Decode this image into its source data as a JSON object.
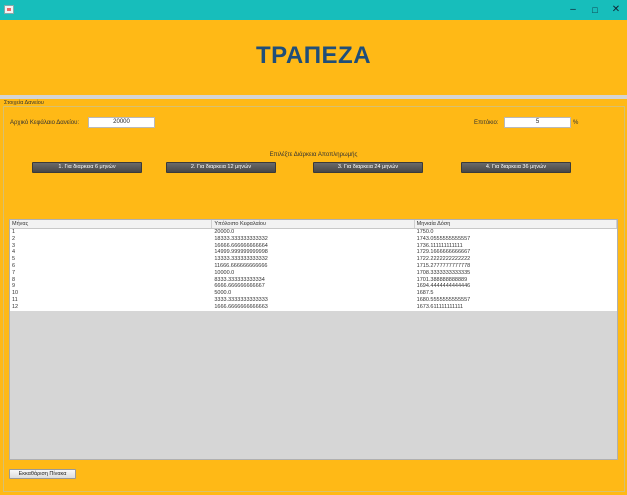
{
  "window": {
    "minimize": "–",
    "maximize": "□",
    "close": "✕"
  },
  "header": {
    "title": "ΤΡΑΠΕΖΑ"
  },
  "panel": {
    "title": "Στοιχεία Δανείου"
  },
  "form": {
    "capital_label": "Αρχικό Κεφάλαιο Δανείου:",
    "capital_value": "20000",
    "rate_label": "Επιτόκιο:",
    "rate_value": "5",
    "rate_unit": "%"
  },
  "duration": {
    "label": "Επιλέξτε Διάρκεια Αποπληρωμής",
    "buttons": [
      "1. Για διαρκεια 6 μηνών",
      "2. Για διαρκεια 12 μηνών",
      "3. Για διαρκεια 24 μηνών",
      "4. Για διαρκεια 36 μηνών"
    ]
  },
  "table": {
    "headers": [
      "Μήνας",
      "Υπόλοιπο Κεφαλαίου",
      "Μηνιαία Δόση"
    ],
    "rows": [
      [
        "1",
        "20000.0",
        "1750.0"
      ],
      [
        "2",
        "18333.333333333332",
        "1743.0555555555557"
      ],
      [
        "3",
        "16666.666666666664",
        "1736.111111111111"
      ],
      [
        "4",
        "14999.999999999998",
        "1729.1666666666667"
      ],
      [
        "5",
        "13333.333333333332",
        "1722.2222222222222"
      ],
      [
        "6",
        "11666.666666666666",
        "1715.2777777777778"
      ],
      [
        "7",
        "10000.0",
        "1708.3333333333335"
      ],
      [
        "8",
        "8333.333333333334",
        "1701.388888888889"
      ],
      [
        "9",
        "6666.666666666667",
        "1694.4444444444446"
      ],
      [
        "10",
        "5000.0",
        "1687.5"
      ],
      [
        "11",
        "3333.3333333333333",
        "1680.5555555555557"
      ],
      [
        "12",
        "1666.6666666666663",
        "1673.611111111111"
      ]
    ]
  },
  "clear_button": "Εκκαθάριση Πίνακα"
}
